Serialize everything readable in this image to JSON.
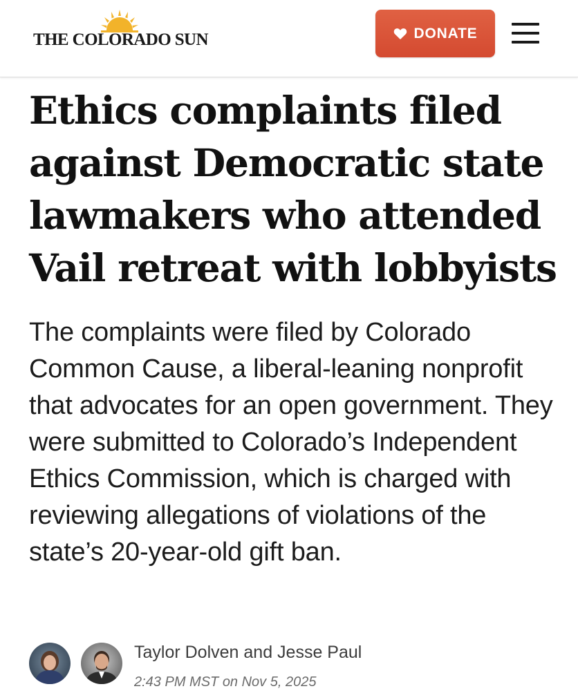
{
  "header": {
    "site_name": "THE COLORADO SUN",
    "logo_icon": "sun-icon",
    "donate_label": "DONATE",
    "donate_icon": "heart-icon",
    "menu_icon": "hamburger-menu-icon",
    "brand_accent": "#d9533a",
    "logo_sun_color": "#f2b32a"
  },
  "article": {
    "headline": "Ethics complaints filed against Democratic state lawmakers who attended Vail retreat with lobbyists",
    "dek": "The complaints were filed by Colorado Common Cause, a liberal-leaning nonprofit that advocates for an open government. They were submitted to Colorado’s Independent Ethics Commission, which is charged with reviewing allegations of violations of the state’s 20-year-old gift ban.",
    "byline": {
      "authors": "Taylor Dolven and Jesse Paul",
      "timestamp": "2:43 PM MST on Nov 5, 2025"
    }
  }
}
